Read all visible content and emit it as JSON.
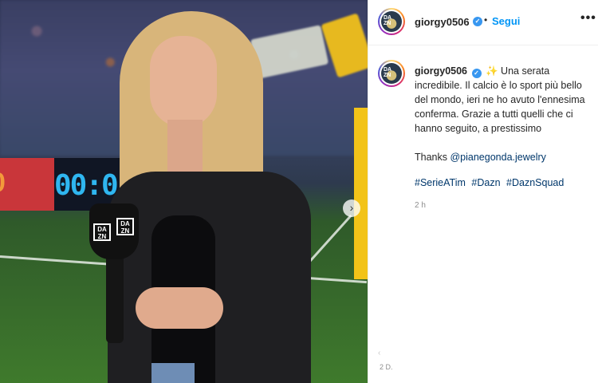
{
  "post": {
    "username": "giorgy0506",
    "follow_label": "Segui",
    "more_label": "•••",
    "separator": "•",
    "caption": {
      "username": "giorgy0506",
      "sparkle": "✨",
      "text": "Una serata incredibile. Il calcio è lo sport più bello del mondo, ieri ne ho avuto l'ennesima conferma. Grazie a tutti quelli che ci hanno seguito, a prestissimo"
    },
    "thanks_prefix": "Thanks",
    "thanks_mention": "@pianegonda.jewelry",
    "hashtags": [
      "#SerieATim",
      "#Dazn",
      "#DaznSquad"
    ],
    "time_ago": "2 h",
    "bottom_time": "2 D.",
    "faint_mark": "‹"
  },
  "media": {
    "scoreboard_left": "0",
    "scoreboard_clock": "00:0",
    "mic_logo": "DA ZN",
    "next_icon": "›"
  },
  "icons": {
    "verified": "verified-badge-icon",
    "next": "chevron-right-icon",
    "more": "more-options-icon"
  },
  "colors": {
    "link": "#00376b",
    "follow": "#0095f6",
    "verified": "#3897f0"
  }
}
